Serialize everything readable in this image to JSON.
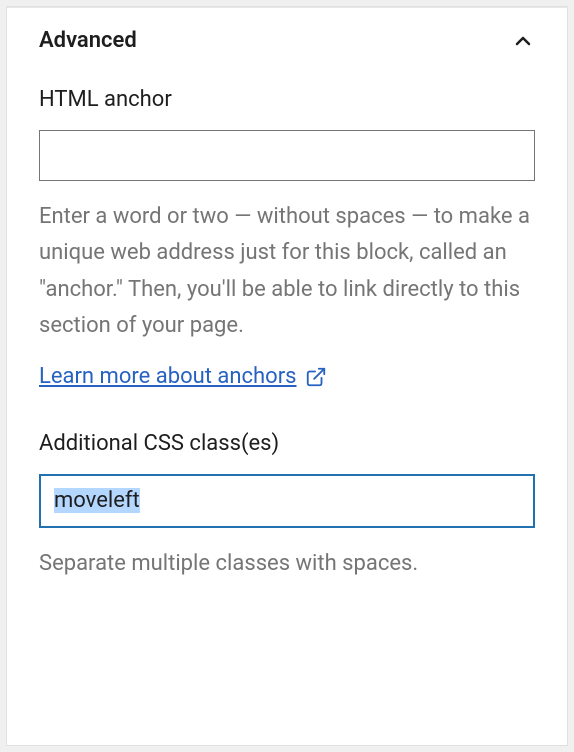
{
  "panel": {
    "title": "Advanced"
  },
  "anchor": {
    "label": "HTML anchor",
    "value": "",
    "help": "Enter a word or two — without spaces — to make a unique web address just for this block, called an \"anchor.\" Then, you'll be able to link directly to this section of your page.",
    "link_text": "Learn more about anchors"
  },
  "css": {
    "label": "Additional CSS class(es)",
    "value": "moveleft",
    "help": "Separate multiple classes with spaces."
  }
}
